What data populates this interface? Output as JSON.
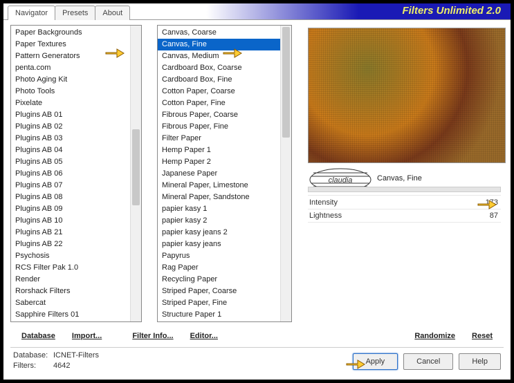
{
  "title": "Filters Unlimited 2.0",
  "tabs": [
    "Navigator",
    "Presets",
    "About"
  ],
  "activeTab": 0,
  "categoryList": [
    "Paper Backgrounds",
    "Paper Textures",
    "Pattern Generators",
    "penta.com",
    "Photo Aging Kit",
    "Photo Tools",
    "Pixelate",
    "Plugins AB 01",
    "Plugins AB 02",
    "Plugins AB 03",
    "Plugins AB 04",
    "Plugins AB 05",
    "Plugins AB 06",
    "Plugins AB 07",
    "Plugins AB 08",
    "Plugins AB 09",
    "Plugins AB 10",
    "Plugins AB 21",
    "Plugins AB 22",
    "Psychosis",
    "RCS Filter Pak 1.0",
    "Render",
    "Rorshack Filters",
    "Sabercat",
    "Sapphire Filters 01"
  ],
  "filterList": [
    "Canvas, Coarse",
    "Canvas, Fine",
    "Canvas, Medium",
    "Cardboard Box, Coarse",
    "Cardboard Box, Fine",
    "Cotton Paper, Coarse",
    "Cotton Paper, Fine",
    "Fibrous Paper, Coarse",
    "Fibrous Paper, Fine",
    "Filter Paper",
    "Hemp Paper 1",
    "Hemp Paper 2",
    "Japanese Paper",
    "Mineral Paper, Limestone",
    "Mineral Paper, Sandstone",
    "papier kasy 1",
    "papier kasy 2",
    "papier kasy jeans 2",
    "papier kasy jeans",
    "Papyrus",
    "Rag Paper",
    "Recycling Paper",
    "Striped Paper, Coarse",
    "Striped Paper, Fine",
    "Structure Paper 1"
  ],
  "selectedFilterIndex": 1,
  "currentFilterName": "Canvas, Fine",
  "logoText": "claudia",
  "params": [
    {
      "name": "Intensity",
      "value": 173
    },
    {
      "name": "Lightness",
      "value": 87
    }
  ],
  "bottomLinks": {
    "database": "Database",
    "import": "Import...",
    "filterInfo": "Filter Info...",
    "editor": "Editor...",
    "randomize": "Randomize",
    "reset": "Reset"
  },
  "status": {
    "dbLabel": "Database:",
    "dbValue": "ICNET-Filters",
    "filtersLabel": "Filters:",
    "filtersValue": "4642"
  },
  "buttons": {
    "apply": "Apply",
    "cancel": "Cancel",
    "help": "Help"
  }
}
